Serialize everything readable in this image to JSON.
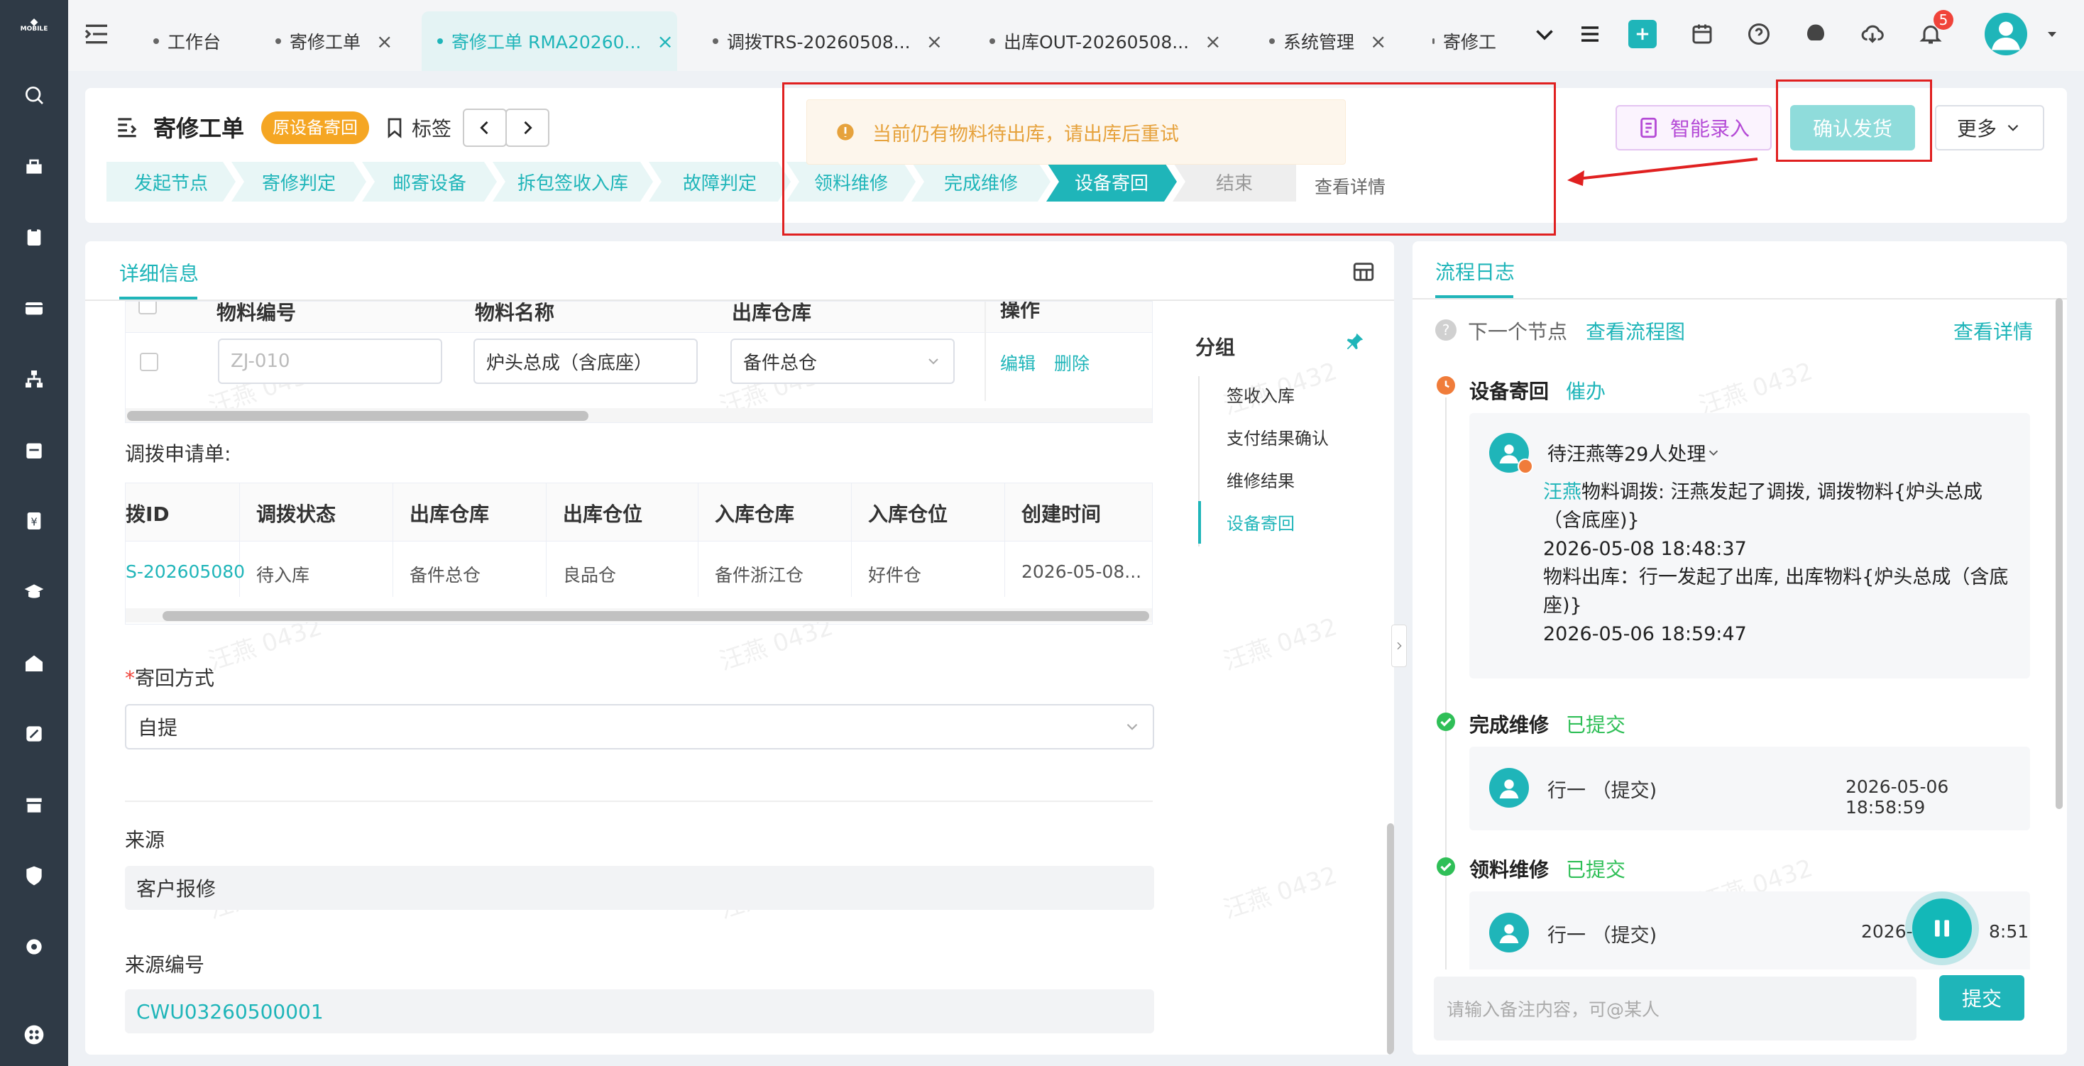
{
  "rail": {
    "logo": "MOBILE"
  },
  "tabs": [
    {
      "label": "工作台",
      "closable": false
    },
    {
      "label": "寄修工单",
      "closable": true
    },
    {
      "label": "寄修工单 RMA20260...",
      "closable": true,
      "active": true
    },
    {
      "label": "调拨TRS-20260508...",
      "closable": true
    },
    {
      "label": "出库OUT-20260508...",
      "closable": true
    },
    {
      "label": "系统管理",
      "closable": true
    },
    {
      "label": "寄修工",
      "closable": false
    }
  ],
  "topbar": {
    "notification_count": "5"
  },
  "header": {
    "title": "寄修工单",
    "badge": "原设备寄回",
    "tag_label": "标签",
    "steps": [
      "发起节点",
      "寄修判定",
      "邮寄设备",
      "拆包签收入库",
      "故障判定",
      "领料维修",
      "完成维修",
      "设备寄回",
      "结束"
    ],
    "current_step_index": 7,
    "view_details": "查看详情",
    "warning": "当前仍有物料待出库，请出库后重试",
    "smart_entry": "智能录入",
    "confirm_ship": "确认发货",
    "more": "更多"
  },
  "detail": {
    "tab": "详细信息",
    "material_table": {
      "headers": [
        "物料编号",
        "物料名称",
        "出库仓库",
        "操作"
      ],
      "row": {
        "code_placeholder": "ZJ-010",
        "name": "炉头总成（含底座）",
        "warehouse": "备件总仓",
        "edit": "编辑",
        "delete": "删除"
      }
    },
    "transfer_label": "调拨申请单:",
    "transfer_table": {
      "headers": [
        "拨ID",
        "调拨状态",
        "出库仓库",
        "出库仓位",
        "入库仓库",
        "入库仓位",
        "创建时间"
      ],
      "row": [
        "S-202605080",
        "待入库",
        "备件总仓",
        "良品仓",
        "备件浙江仓",
        "好件仓",
        "2026-05-08..."
      ]
    },
    "return_method_label": "寄回方式",
    "return_method_value": "自提",
    "source_label": "来源",
    "source_value": "客户报修",
    "source_no_label": "来源编号",
    "source_no_value": "CWU03260500001",
    "group": {
      "title": "分组",
      "items": [
        "签收入库",
        "支付结果确认",
        "维修结果",
        "设备寄回"
      ],
      "active_index": 3
    },
    "watermark": "汪燕 0432"
  },
  "log": {
    "tab": "流程日志",
    "next_node": "下一个节点",
    "view_flow": "查看流程图",
    "view_details": "查看详情",
    "entries": [
      {
        "node": "设备寄回",
        "action": "催办",
        "pending": "待汪燕等29人处理",
        "user": "汪燕",
        "line1": "物料调拨: 汪燕发起了调拨, 调拨物料{炉头总成",
        "line1b": "（含底座)}",
        "time1": "2026-05-08 18:48:37",
        "line2": "物料出库：行一发起了出库, 出库物料{炉头总成（含底",
        "line2b": "座)}",
        "time2": "2026-05-06 18:59:47"
      },
      {
        "node": "完成维修",
        "status": "已提交",
        "who": "行一 （提交)",
        "time": "2026-05-06 18:58:59"
      },
      {
        "node": "领料维修",
        "status": "已提交",
        "who": "行一 （提交)",
        "time": "2026-0",
        "time_tail": "8:51"
      }
    ],
    "comment_placeholder": "请输入备注内容，可@某人",
    "submit": "提交"
  }
}
